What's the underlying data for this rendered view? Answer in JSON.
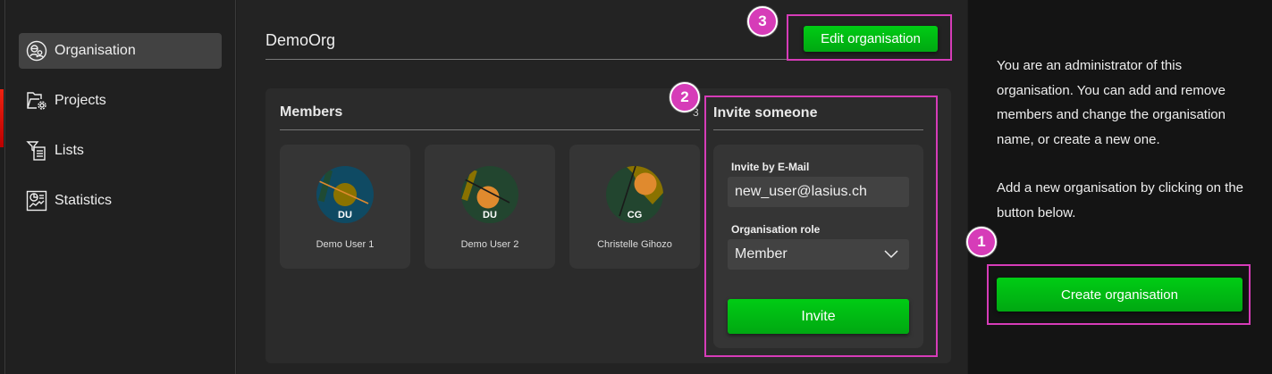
{
  "sidebar": {
    "items": [
      {
        "label": "Organisation",
        "icon": "organisation-icon",
        "active": true
      },
      {
        "label": "Projects",
        "icon": "folder-gear-icon"
      },
      {
        "label": "Lists",
        "icon": "filter-list-icon"
      },
      {
        "label": "Statistics",
        "icon": "statistics-icon"
      }
    ]
  },
  "org": {
    "name": "DemoOrg",
    "edit_label": "Edit organisation"
  },
  "members": {
    "title": "Members",
    "count": "3",
    "list": [
      {
        "initials": "DU",
        "name": "Demo User 1"
      },
      {
        "initials": "DU",
        "name": "Demo User 2"
      },
      {
        "initials": "CG",
        "name": "Christelle Gihozo"
      }
    ]
  },
  "invite": {
    "title": "Invite someone",
    "email_label": "Invite by E-Mail",
    "email_value": "new_user@lasius.ch",
    "role_label": "Organisation role",
    "role_value": "Member",
    "button": "Invite"
  },
  "info": {
    "text1": "You are an administrator of this organisation. You can add and remove members and change the organisation name, or create a new one.",
    "text2": "Add a new organisation by clicking on the button below.",
    "create_label": "Create organisation"
  },
  "annotations": [
    "1",
    "2",
    "3"
  ],
  "colors": {
    "accent": "#00c012",
    "highlight": "#d63cb8"
  }
}
